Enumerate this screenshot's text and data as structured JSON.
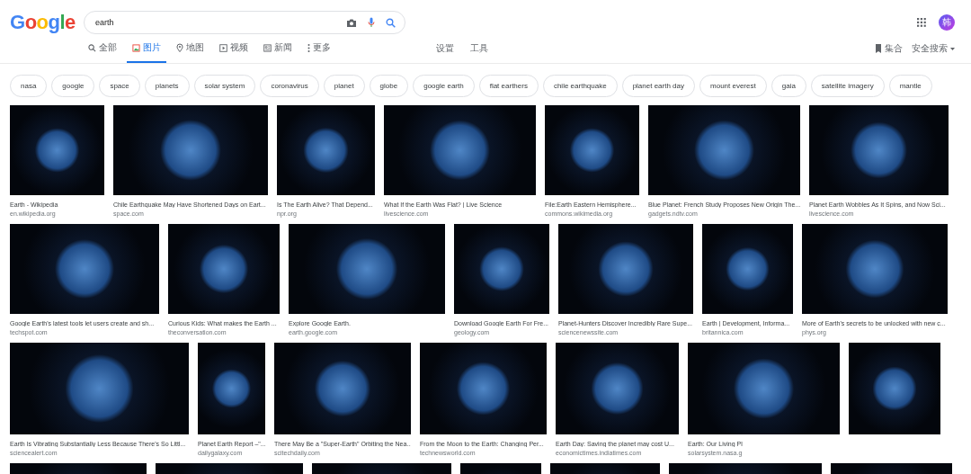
{
  "search": {
    "value": "earth"
  },
  "header": {
    "logo": "Google",
    "avatar": "韩"
  },
  "tabs": [
    {
      "label": "全部",
      "kind": "search",
      "selected": false
    },
    {
      "label": "图片",
      "kind": "image",
      "selected": true
    },
    {
      "label": "地图",
      "kind": "map",
      "selected": false
    },
    {
      "label": "视频",
      "kind": "video",
      "selected": false
    },
    {
      "label": "新闻",
      "kind": "news",
      "selected": false
    },
    {
      "label": "更多",
      "kind": "more",
      "selected": false
    }
  ],
  "tools": [
    "设置",
    "工具"
  ],
  "right_links": [
    {
      "label": "集合",
      "kind": "collection"
    },
    {
      "label": "安全搜索",
      "kind": "safesearch"
    }
  ],
  "chips": [
    "nasa",
    "google",
    "space",
    "planets",
    "solar system",
    "coronavirus",
    "planet",
    "globe",
    "google earth",
    "flat earthers",
    "chile earthquake",
    "planet earth day",
    "mount everest",
    "gaia",
    "satellite imagery",
    "mantle"
  ],
  "rows": [
    [
      {
        "title": "Earth - Wikipedia",
        "source": "en.wikipedia.org"
      },
      {
        "title": "Chile Earthquake May Have Shortened Days on Eart...",
        "source": "space.com"
      },
      {
        "title": "Is The Earth Alive? That Depend...",
        "source": "npr.org"
      },
      {
        "title": "What If the Earth Was Flat? | Live Science",
        "source": "livescience.com"
      },
      {
        "title": "File:Earth Eastern Hemisphere...",
        "source": "commons.wikimedia.org"
      },
      {
        "title": "Blue Planet: French Study Proposes New Origin The...",
        "source": "gadgets.ndtv.com"
      },
      {
        "title": "Planet Earth Wobbles As It Spins, and Now Sci...",
        "source": "livescience.com"
      }
    ],
    [
      {
        "title": "Google Earth's latest tools let users create and sh...",
        "source": "techspot.com"
      },
      {
        "title": "Curious Kids: What makes the Earth ...",
        "source": "theconversation.com"
      },
      {
        "title": "Explore Google Earth.",
        "source": "earth.google.com"
      },
      {
        "title": "Download Google Earth For Fre...",
        "source": "geology.com"
      },
      {
        "title": "Planet-Hunters Discover Incredibly Rare Supe...",
        "source": "sciencenewssite.com"
      },
      {
        "title": "Earth | Development, Informa...",
        "source": "britannica.com"
      },
      {
        "title": "More of Earth's secrets to be unlocked with new c...",
        "source": "phys.org"
      }
    ],
    [
      {
        "title": "Earth Is Vibrating Substantially Less Because There's So Littl...",
        "source": "sciencealert.com"
      },
      {
        "title": "Planet Earth Report –\"...",
        "source": "dailygalaxy.com"
      },
      {
        "title": "There May Be a \"Super-Earth\" Orbiting the Nea...",
        "source": "scitechdaily.com"
      },
      {
        "title": "From the Moon to the Earth: Changing Per...",
        "source": "technewsworld.com"
      },
      {
        "title": "Earth Day: Saving the planet may cost U...",
        "source": "economictimes.indiatimes.com"
      },
      {
        "title": "Earth: Our Living Pl",
        "source": "solarsystem.nasa.g"
      }
    ]
  ]
}
